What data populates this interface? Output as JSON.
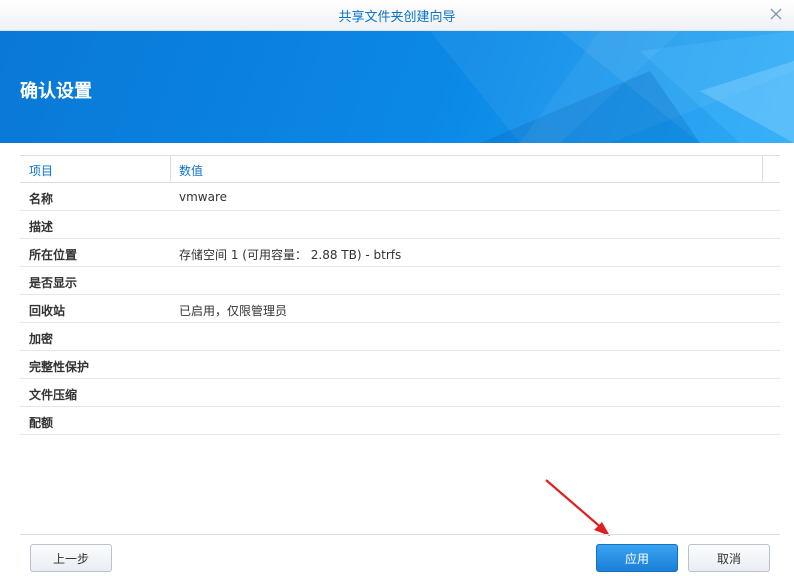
{
  "window": {
    "title": "共享文件夹创建向导"
  },
  "banner": {
    "title": "确认设置"
  },
  "table": {
    "headers": {
      "item": "项目",
      "value": "数值"
    },
    "rows": [
      {
        "item": "名称",
        "value": "vmware"
      },
      {
        "item": "描述",
        "value": ""
      },
      {
        "item": "所在位置",
        "value": "存储空间 1 (可用容量： 2.88 TB) - btrfs"
      },
      {
        "item": "是否显示",
        "value": ""
      },
      {
        "item": "回收站",
        "value": "已启用，仅限管理员"
      },
      {
        "item": "加密",
        "value": ""
      },
      {
        "item": "完整性保护",
        "value": ""
      },
      {
        "item": "文件压缩",
        "value": ""
      },
      {
        "item": "配额",
        "value": ""
      }
    ]
  },
  "footer": {
    "back_label": "上一步",
    "apply_label": "应用",
    "cancel_label": "取消"
  },
  "icons": {
    "close": "close-icon",
    "annotation": "red-arrow-icon"
  },
  "colors": {
    "accent": "#0b73c7",
    "banner": "#0a80dd",
    "apply_button": "#2088dc",
    "arrow": "#e02020"
  }
}
